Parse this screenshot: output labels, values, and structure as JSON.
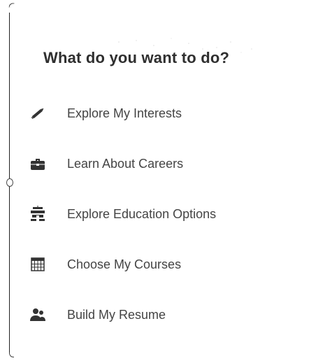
{
  "panel": {
    "title": "What do you want to do?",
    "menu": [
      {
        "label": "Explore My Interests",
        "icon": "pencil-icon"
      },
      {
        "label": "Learn About Careers",
        "icon": "briefcase-icon"
      },
      {
        "label": "Explore Education Options",
        "icon": "school-building-icon"
      },
      {
        "label": "Choose My Courses",
        "icon": "calendar-grid-icon"
      },
      {
        "label": "Build My Resume",
        "icon": "users-icon"
      }
    ]
  },
  "colors": {
    "title": "#2f2f2f",
    "label": "#444444",
    "icon": "#333333",
    "background": "#ffffff"
  }
}
